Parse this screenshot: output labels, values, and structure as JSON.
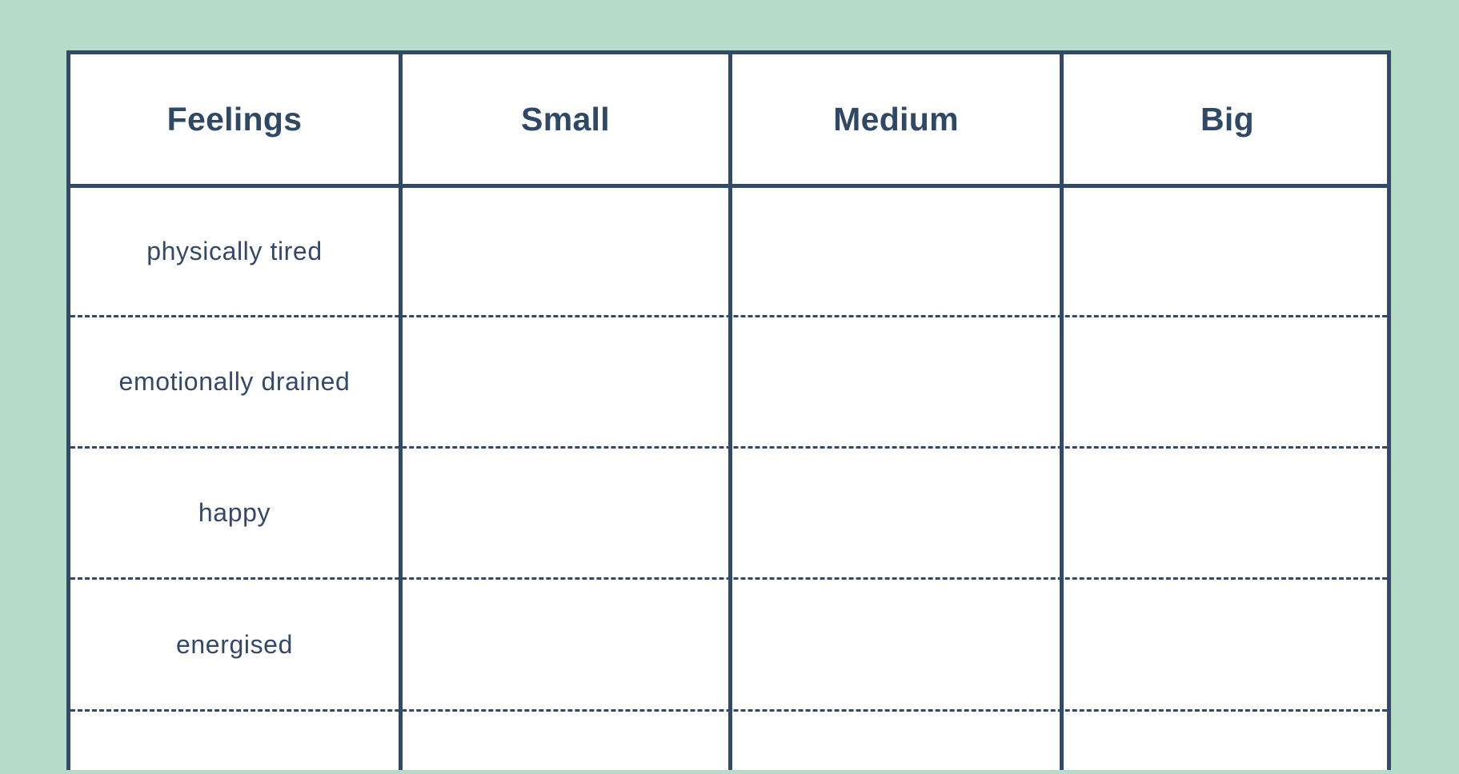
{
  "table": {
    "headers": [
      "Feelings",
      "Small",
      "Medium",
      "Big"
    ],
    "rows": [
      {
        "feeling": "physically tired",
        "small": "",
        "medium": "",
        "big": ""
      },
      {
        "feeling": "emotionally drained",
        "small": "",
        "medium": "",
        "big": ""
      },
      {
        "feeling": "happy",
        "small": "",
        "medium": "",
        "big": ""
      },
      {
        "feeling": "energised",
        "small": "",
        "medium": "",
        "big": ""
      },
      {
        "feeling": "",
        "small": "",
        "medium": "",
        "big": ""
      }
    ]
  },
  "colors": {
    "background": "#b4dcc9",
    "ink": "#334a66",
    "sheet": "#ffffff"
  }
}
